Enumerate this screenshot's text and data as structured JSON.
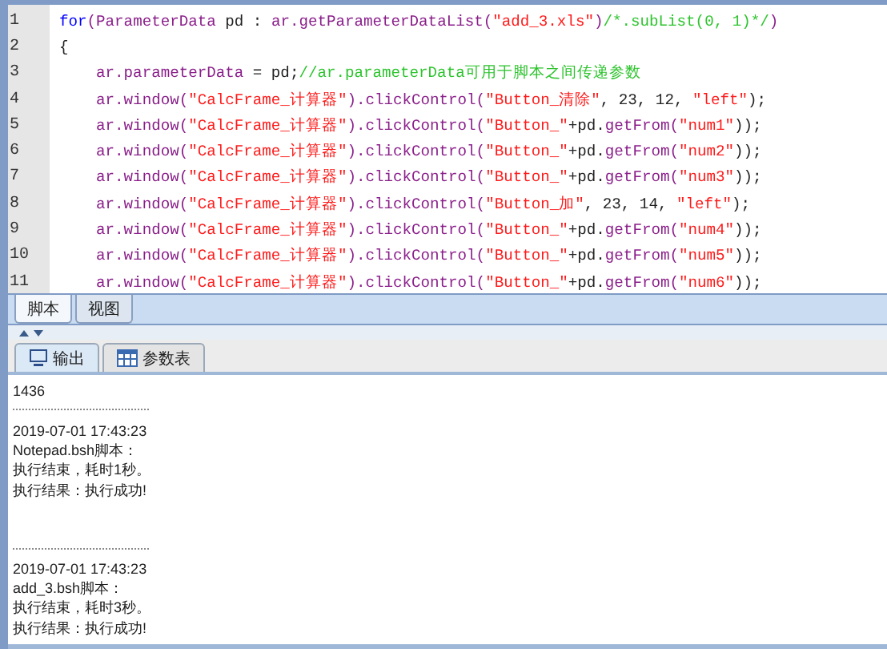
{
  "editor": {
    "lines": [
      {
        "number": "1",
        "tokens": [
          {
            "kind": "keyword",
            "text": "for"
          },
          {
            "kind": "method",
            "text": "(ParameterData"
          },
          {
            "kind": "plain",
            "text": " pd : "
          },
          {
            "kind": "method",
            "text": "ar.getParameterDataList("
          },
          {
            "kind": "string",
            "text": "\"add_3.xls\""
          },
          {
            "kind": "method",
            "text": ")"
          },
          {
            "kind": "comment",
            "text": "/*.subList(0, 1)*/"
          },
          {
            "kind": "method",
            "text": ")"
          }
        ]
      },
      {
        "number": "2",
        "tokens": [
          {
            "kind": "plain",
            "text": "{"
          }
        ]
      },
      {
        "number": "3",
        "tokens": [
          {
            "kind": "method",
            "text": "    ar.parameterData"
          },
          {
            "kind": "plain",
            "text": " = pd;"
          },
          {
            "kind": "comment",
            "text": "//ar.parameterData可用于脚本之间传递参数"
          }
        ]
      },
      {
        "number": "4",
        "tokens": [
          {
            "kind": "method",
            "text": "    ar.window("
          },
          {
            "kind": "string",
            "text": "\"CalcFrame_计算器\""
          },
          {
            "kind": "method",
            "text": ").clickControl("
          },
          {
            "kind": "string",
            "text": "\"Button_清除\""
          },
          {
            "kind": "plain",
            "text": ", 23, 12, "
          },
          {
            "kind": "string",
            "text": "\"left\""
          },
          {
            "kind": "plain",
            "text": ");"
          }
        ]
      },
      {
        "number": "5",
        "tokens": [
          {
            "kind": "method",
            "text": "    ar.window("
          },
          {
            "kind": "string",
            "text": "\"CalcFrame_计算器\""
          },
          {
            "kind": "method",
            "text": ").clickControl("
          },
          {
            "kind": "string",
            "text": "\"Button_\""
          },
          {
            "kind": "plain",
            "text": "+pd."
          },
          {
            "kind": "method",
            "text": "getFrom("
          },
          {
            "kind": "string",
            "text": "\"num1\""
          },
          {
            "kind": "plain",
            "text": "));"
          }
        ]
      },
      {
        "number": "6",
        "tokens": [
          {
            "kind": "method",
            "text": "    ar.window("
          },
          {
            "kind": "string",
            "text": "\"CalcFrame_计算器\""
          },
          {
            "kind": "method",
            "text": ").clickControl("
          },
          {
            "kind": "string",
            "text": "\"Button_\""
          },
          {
            "kind": "plain",
            "text": "+pd."
          },
          {
            "kind": "method",
            "text": "getFrom("
          },
          {
            "kind": "string",
            "text": "\"num2\""
          },
          {
            "kind": "plain",
            "text": "));"
          }
        ]
      },
      {
        "number": "7",
        "tokens": [
          {
            "kind": "method",
            "text": "    ar.window("
          },
          {
            "kind": "string",
            "text": "\"CalcFrame_计算器\""
          },
          {
            "kind": "method",
            "text": ").clickControl("
          },
          {
            "kind": "string",
            "text": "\"Button_\""
          },
          {
            "kind": "plain",
            "text": "+pd."
          },
          {
            "kind": "method",
            "text": "getFrom("
          },
          {
            "kind": "string",
            "text": "\"num3\""
          },
          {
            "kind": "plain",
            "text": "));"
          }
        ]
      },
      {
        "number": "8",
        "tokens": [
          {
            "kind": "method",
            "text": "    ar.window("
          },
          {
            "kind": "string",
            "text": "\"CalcFrame_计算器\""
          },
          {
            "kind": "method",
            "text": ").clickControl("
          },
          {
            "kind": "string",
            "text": "\"Button_加\""
          },
          {
            "kind": "plain",
            "text": ", 23, 14, "
          },
          {
            "kind": "string",
            "text": "\"left\""
          },
          {
            "kind": "plain",
            "text": ");"
          }
        ]
      },
      {
        "number": "9",
        "tokens": [
          {
            "kind": "method",
            "text": "    ar.window("
          },
          {
            "kind": "string",
            "text": "\"CalcFrame_计算器\""
          },
          {
            "kind": "method",
            "text": ").clickControl("
          },
          {
            "kind": "string",
            "text": "\"Button_\""
          },
          {
            "kind": "plain",
            "text": "+pd."
          },
          {
            "kind": "method",
            "text": "getFrom("
          },
          {
            "kind": "string",
            "text": "\"num4\""
          },
          {
            "kind": "plain",
            "text": "));"
          }
        ]
      },
      {
        "number": "10",
        "tokens": [
          {
            "kind": "method",
            "text": "    ar.window("
          },
          {
            "kind": "string",
            "text": "\"CalcFrame_计算器\""
          },
          {
            "kind": "method",
            "text": ").clickControl("
          },
          {
            "kind": "string",
            "text": "\"Button_\""
          },
          {
            "kind": "plain",
            "text": "+pd."
          },
          {
            "kind": "method",
            "text": "getFrom("
          },
          {
            "kind": "string",
            "text": "\"num5\""
          },
          {
            "kind": "plain",
            "text": "));"
          }
        ]
      },
      {
        "number": "11",
        "tokens": [
          {
            "kind": "method",
            "text": "    ar.window("
          },
          {
            "kind": "string",
            "text": "\"CalcFrame_计算器\""
          },
          {
            "kind": "method",
            "text": ").clickControl("
          },
          {
            "kind": "string",
            "text": "\"Button_\""
          },
          {
            "kind": "plain",
            "text": "+pd."
          },
          {
            "kind": "method",
            "text": "getFrom("
          },
          {
            "kind": "string",
            "text": "\"num6\""
          },
          {
            "kind": "plain",
            "text": "));"
          }
        ]
      }
    ]
  },
  "editor_tabs": [
    {
      "label": "脚本",
      "selected": true
    },
    {
      "label": "视图",
      "selected": false
    }
  ],
  "output_tabs": [
    {
      "label": "输出",
      "kind": "monitor",
      "selected": true
    },
    {
      "label": "参数表",
      "kind": "table",
      "selected": false
    }
  ],
  "output": [
    {
      "kind": "text",
      "text": "1436"
    },
    {
      "kind": "separator"
    },
    {
      "kind": "text",
      "text": "2019-07-01 17:43:23"
    },
    {
      "kind": "text",
      "text": "Notepad.bsh脚本："
    },
    {
      "kind": "text",
      "text": "执行结束，耗时1秒。"
    },
    {
      "kind": "text",
      "text": "执行结果：执行成功!"
    },
    {
      "kind": "blank"
    },
    {
      "kind": "blank"
    },
    {
      "kind": "separator"
    },
    {
      "kind": "text",
      "text": "2019-07-01 17:43:23"
    },
    {
      "kind": "text",
      "text": "add_3.bsh脚本："
    },
    {
      "kind": "text",
      "text": "执行结束，耗时3秒。"
    },
    {
      "kind": "text",
      "text": "执行结果：执行成功!"
    }
  ]
}
